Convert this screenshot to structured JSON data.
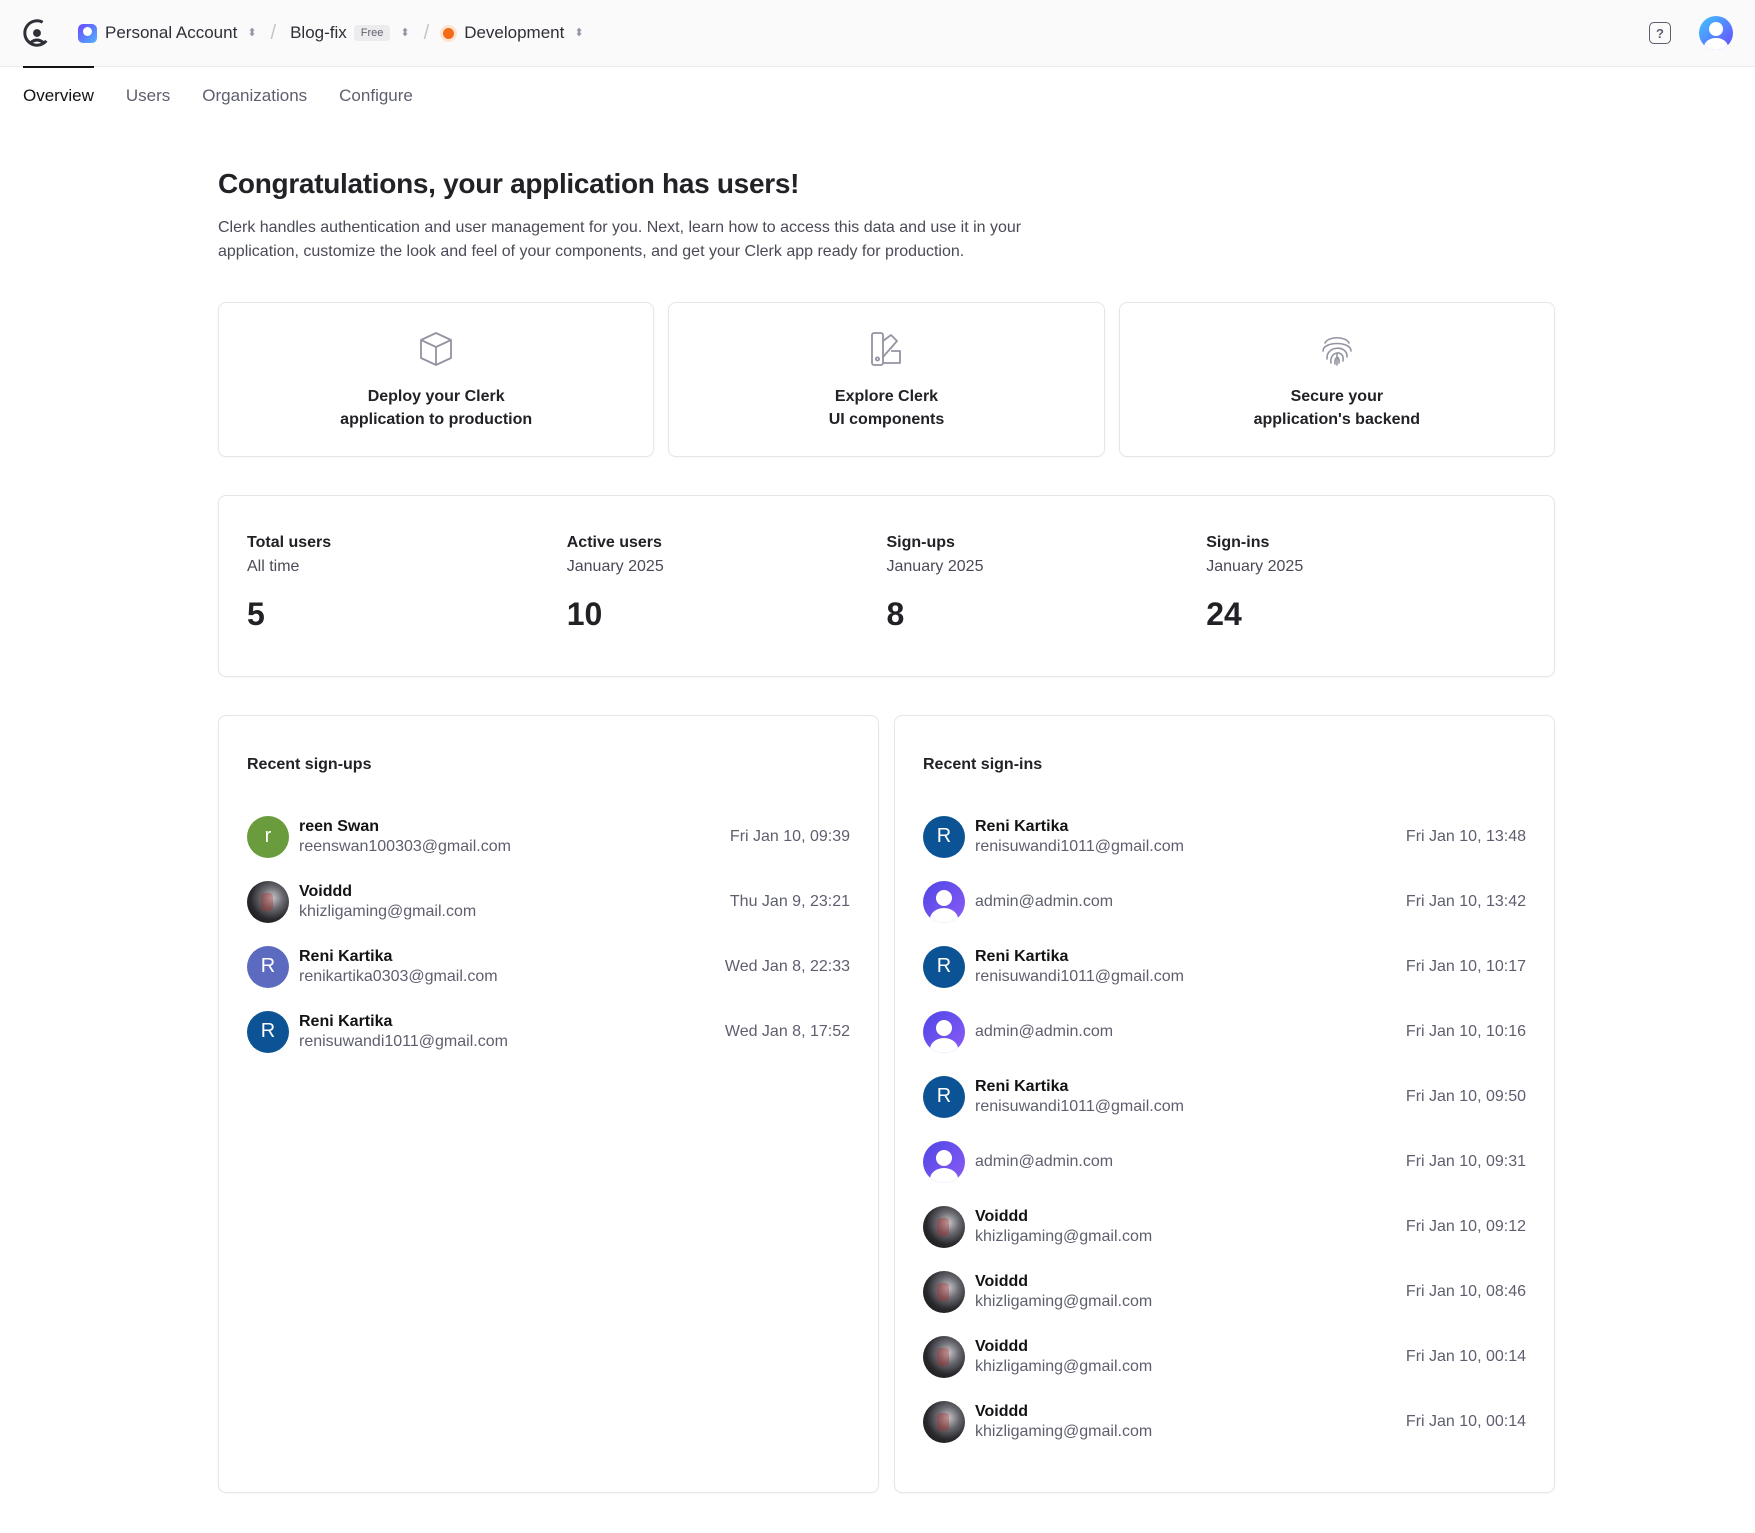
{
  "topbar": {
    "account": "Personal Account",
    "app": "Blog-fix",
    "plan": "Free",
    "environment": "Development",
    "environment_color": "#f36b16",
    "help_icon": "?"
  },
  "tabs": [
    {
      "label": "Overview",
      "active": true
    },
    {
      "label": "Users"
    },
    {
      "label": "Organizations"
    },
    {
      "label": "Configure"
    }
  ],
  "intro": {
    "title": "Congratulations, your application has users!",
    "description": "Clerk handles authentication and user management for you. Next, learn how to access this data and use it in your application, customize the look and feel of your components, and get your Clerk app ready for production."
  },
  "actions": [
    {
      "line1": "Deploy your Clerk",
      "line2": "application to production",
      "icon": "box-icon"
    },
    {
      "line1": "Explore Clerk",
      "line2": "UI components",
      "icon": "swatch-icon"
    },
    {
      "line1": "Secure your",
      "line2": "application's backend",
      "icon": "fingerprint-icon"
    }
  ],
  "stats": [
    {
      "label": "Total users",
      "sub": "All time",
      "value": "5"
    },
    {
      "label": "Active users",
      "sub": "January 2025",
      "value": "10"
    },
    {
      "label": "Sign-ups",
      "sub": "January 2025",
      "value": "8"
    },
    {
      "label": "Sign-ins",
      "sub": "January 2025",
      "value": "24"
    }
  ],
  "recent_signups": {
    "title": "Recent sign-ups",
    "items": [
      {
        "name": "reen Swan",
        "email": "reenswan100303@gmail.com",
        "time": "Fri Jan 10, 09:39",
        "initial": "r",
        "avatar": "green"
      },
      {
        "name": "Voiddd",
        "email": "khizligaming@gmail.com",
        "time": "Thu Jan 9, 23:21",
        "initial": "",
        "avatar": "dark"
      },
      {
        "name": "Reni Kartika",
        "email": "renikartika0303@gmail.com",
        "time": "Wed Jan 8, 22:33",
        "initial": "R",
        "avatar": "purple"
      },
      {
        "name": "Reni Kartika",
        "email": "renisuwandi1011@gmail.com",
        "time": "Wed Jan 8, 17:52",
        "initial": "R",
        "avatar": "blue"
      }
    ]
  },
  "recent_signins": {
    "title": "Recent sign-ins",
    "items": [
      {
        "name": "Reni Kartika",
        "email": "renisuwandi1011@gmail.com",
        "time": "Fri Jan 10, 13:48",
        "initial": "R",
        "avatar": "blue"
      },
      {
        "name": "",
        "email": "admin@admin.com",
        "time": "Fri Jan 10, 13:42",
        "initial": "",
        "avatar": "default"
      },
      {
        "name": "Reni Kartika",
        "email": "renisuwandi1011@gmail.com",
        "time": "Fri Jan 10, 10:17",
        "initial": "R",
        "avatar": "blue"
      },
      {
        "name": "",
        "email": "admin@admin.com",
        "time": "Fri Jan 10, 10:16",
        "initial": "",
        "avatar": "default"
      },
      {
        "name": "Reni Kartika",
        "email": "renisuwandi1011@gmail.com",
        "time": "Fri Jan 10, 09:50",
        "initial": "R",
        "avatar": "blue"
      },
      {
        "name": "",
        "email": "admin@admin.com",
        "time": "Fri Jan 10, 09:31",
        "initial": "",
        "avatar": "default"
      },
      {
        "name": "Voiddd",
        "email": "khizligaming@gmail.com",
        "time": "Fri Jan 10, 09:12",
        "initial": "",
        "avatar": "dark"
      },
      {
        "name": "Voiddd",
        "email": "khizligaming@gmail.com",
        "time": "Fri Jan 10, 08:46",
        "initial": "",
        "avatar": "dark"
      },
      {
        "name": "Voiddd",
        "email": "khizligaming@gmail.com",
        "time": "Fri Jan 10, 00:14",
        "initial": "",
        "avatar": "dark"
      },
      {
        "name": "Voiddd",
        "email": "khizligaming@gmail.com",
        "time": "Fri Jan 10, 00:14",
        "initial": "",
        "avatar": "dark"
      }
    ]
  }
}
